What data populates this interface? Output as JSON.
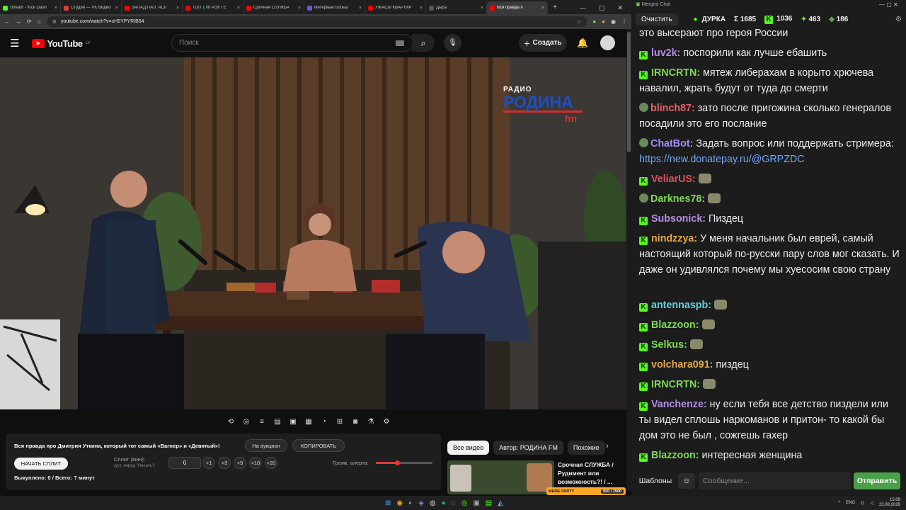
{
  "browser": {
    "tabs": [
      {
        "label": "Stream - Kick Dash",
        "color": "#53fc18"
      },
      {
        "label": "Студия — VK Видео",
        "color": "#e53935"
      },
      {
        "label": "ЗАПАД ПАЛ. АСЛ",
        "color": "#ff0000"
      },
      {
        "label": "ТОП 1 ИГРОК ГЕ",
        "color": "#ff0000"
      },
      {
        "label": "Срочная СЛУЖБА",
        "color": "#ff0000"
      },
      {
        "label": "Интервью Больш",
        "color": "#7b4fd4"
      },
      {
        "label": "УЖАСЫ КВАРТИР",
        "color": "#ff0000"
      },
      {
        "label": "Дыра",
        "color": "#555555"
      },
      {
        "label": "Вся правда п",
        "color": "#ff0000"
      }
    ],
    "new_tab": "+",
    "url": "youtube.com/watch?v=sH5YPYRIB64"
  },
  "youtube": {
    "logo": "YouTube",
    "region": "LV",
    "search_placeholder": "Поиск",
    "create_label": "Создать",
    "video_brand_top": "РАДИО",
    "video_brand_main": "РОДИНА",
    "video_brand_fm": "fm"
  },
  "panel": {
    "title": "Вся правда про Дмитрия Уткина, который тот самый «Вагнер» и «Девятый»!",
    "auction_button": "На аукцион",
    "copy_button": "КОПИРОВАТЬ",
    "start_split_button": "НАЧАТЬ СПЛИТ",
    "split_label": "Сплит (мин):",
    "split_hint": "(уст. перед \"Начать\")",
    "split_value": "0",
    "increments": [
      "+1",
      "+3",
      "+5",
      "+10",
      "+20"
    ],
    "volume_label": "Громк. алерта:",
    "volume_level": 0.38,
    "bought_text": "Выкуплено: 0 / Всего: ? минут"
  },
  "recommendations": {
    "chips": [
      "Все видео",
      "Автор: РОДИНА FM",
      "Похожие"
    ],
    "video_title": "Срочная СЛУЖБА / Рудимент или возможность?! / ...",
    "overlay_label": "MEME PARTY",
    "progress_text": "920 / 1500"
  },
  "chat": {
    "window_title": "Merged Chat",
    "clear_button": "Очистить",
    "streamer": "ДУРКА",
    "total": "Σ 1685",
    "kick_count": "1036",
    "other_count": "463",
    "frog_count": "186",
    "messages": [
      {
        "user": "",
        "text": "это высерают про героя России",
        "color": "#ececec",
        "badge": "none"
      },
      {
        "user": "luv2k:",
        "text": "поспорили как лучше ебашить",
        "color": "#b48ce0",
        "badge": "kick"
      },
      {
        "user": "IRNCRTN:",
        "text": "мятеж либерахам в корыто хрючева навалил, жрать будут от туда до смерти",
        "color": "#7ed957",
        "badge": "kick"
      },
      {
        "user": "blinch87:",
        "text": "зато после пригожина сколько генералов посадили  это его послание",
        "color": "#e06666",
        "badge": "avatar"
      },
      {
        "user": "ChatBot:",
        "text": "Задать вопрос или поддержать стримера:",
        "link": "https://new.donatepay.ru/@GRPZDC",
        "color": "#a58cff",
        "badge": "avatar"
      },
      {
        "user": "VeliarUS:",
        "text": "",
        "color": "#e0525b",
        "badge": "kick",
        "emote": true
      },
      {
        "user": "Darknes78:",
        "text": "",
        "color": "#7ed957",
        "badge": "avatar",
        "emote": true
      },
      {
        "user": "Subsonick:",
        "text": "Пиздец",
        "color": "#b48ce0",
        "badge": "kick"
      },
      {
        "user": "nindzzya:",
        "text": "У меня начальник был еврей, самый настоящий который по-русски пару слов мог сказать. И даже он удивлялся почему мы хуесосим свою страну",
        "color": "#e0a84a",
        "badge": "kick"
      },
      {
        "user": "antennaspb:",
        "text": "",
        "color": "#5fd3e0",
        "badge": "kick",
        "emote": true
      },
      {
        "user": "Blazzoon:",
        "text": "",
        "color": "#7ed957",
        "badge": "kick",
        "emote": true
      },
      {
        "user": "Selkus:",
        "text": "",
        "color": "#7ed957",
        "badge": "kick",
        "emote": true
      },
      {
        "user": "volchara091:",
        "text": "пиздец",
        "color": "#e0a84a",
        "badge": "kick"
      },
      {
        "user": "IRNCRTN:",
        "text": "",
        "color": "#7ed957",
        "badge": "kick",
        "emote": true
      },
      {
        "user": "Vanchenze:",
        "text": "ну если тебя все детство пиздели или ты видел сплошь наркоманов и притон- то какой бы дом это не был , сожгешь гахер",
        "color": "#b48ce0",
        "badge": "kick"
      },
      {
        "user": "Blazzoon:",
        "text": "интересная женщина",
        "color": "#7ed957",
        "badge": "kick"
      }
    ],
    "templates_button": "Шаблоны",
    "input_placeholder": "Сообщение...",
    "send_button": "Отправить"
  },
  "taskbar": {
    "lang": "ENG",
    "time": "15:09",
    "date": "23.08.2026"
  }
}
